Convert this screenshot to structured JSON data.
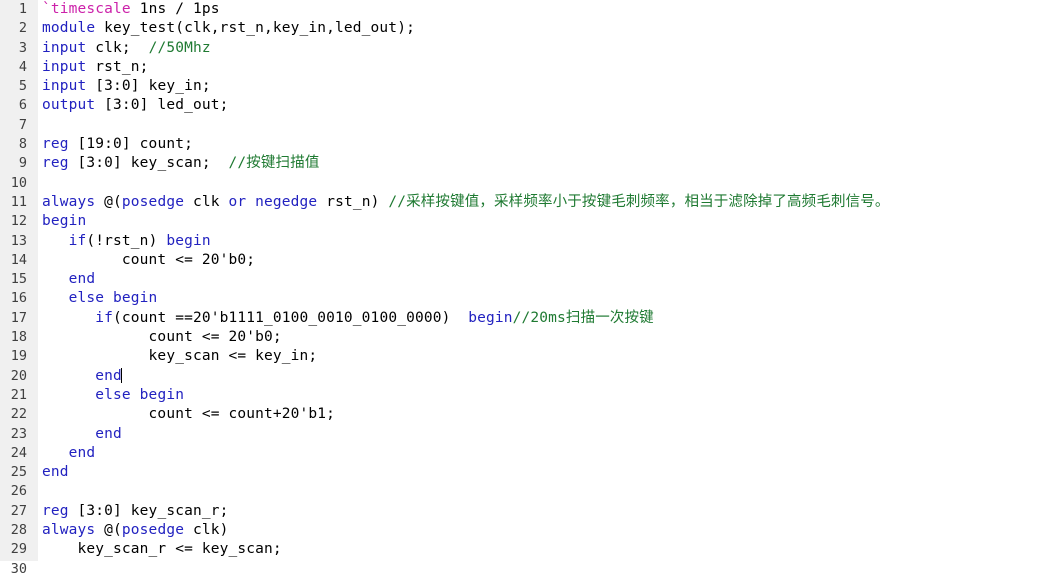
{
  "editor": {
    "language": "verilog",
    "file_kind": "source-code",
    "total_lines_visible": 30,
    "caret": {
      "line": 20,
      "after_text": "end"
    },
    "colors": {
      "background": "#ffffff",
      "gutter_background": "#f0f0f0",
      "line_number": "#404040",
      "plain": "#000000",
      "keyword": "#2222c0",
      "comment": "#1f7a32",
      "directive": "#cc22aa",
      "caret": "#000000"
    }
  },
  "lines": [
    {
      "number": "1",
      "tokens": [
        {
          "t": "directive",
          "s": "`timescale"
        },
        {
          "t": "plain",
          "s": " 1ns / 1ps"
        }
      ]
    },
    {
      "number": "2",
      "tokens": [
        {
          "t": "keyword",
          "s": "module"
        },
        {
          "t": "plain",
          "s": " key_test(clk,rst_n,key_in,led_out);"
        }
      ]
    },
    {
      "number": "3",
      "tokens": [
        {
          "t": "keyword",
          "s": "input"
        },
        {
          "t": "plain",
          "s": " clk;  "
        },
        {
          "t": "comment",
          "s": "//50Mhz"
        }
      ]
    },
    {
      "number": "4",
      "tokens": [
        {
          "t": "keyword",
          "s": "input"
        },
        {
          "t": "plain",
          "s": " rst_n;"
        }
      ]
    },
    {
      "number": "5",
      "tokens": [
        {
          "t": "keyword",
          "s": "input"
        },
        {
          "t": "plain",
          "s": " [3:0] key_in;"
        }
      ]
    },
    {
      "number": "6",
      "tokens": [
        {
          "t": "keyword",
          "s": "output"
        },
        {
          "t": "plain",
          "s": " [3:0] led_out;"
        }
      ]
    },
    {
      "number": "7",
      "tokens": []
    },
    {
      "number": "8",
      "tokens": [
        {
          "t": "keyword",
          "s": "reg"
        },
        {
          "t": "plain",
          "s": " [19:0] count;"
        }
      ]
    },
    {
      "number": "9",
      "tokens": [
        {
          "t": "keyword",
          "s": "reg"
        },
        {
          "t": "plain",
          "s": " [3:0] key_scan;  "
        },
        {
          "t": "comment",
          "s": "//按键扫描值"
        }
      ]
    },
    {
      "number": "10",
      "tokens": []
    },
    {
      "number": "11",
      "tokens": [
        {
          "t": "keyword",
          "s": "always"
        },
        {
          "t": "plain",
          "s": " @("
        },
        {
          "t": "keyword",
          "s": "posedge"
        },
        {
          "t": "plain",
          "s": " clk "
        },
        {
          "t": "keyword",
          "s": "or"
        },
        {
          "t": "plain",
          "s": " "
        },
        {
          "t": "keyword",
          "s": "negedge"
        },
        {
          "t": "plain",
          "s": " rst_n) "
        },
        {
          "t": "comment",
          "s": "//采样按键值，采样频率小于按键毛刺频率，相当于滤除掉了高频毛刺信号。"
        }
      ]
    },
    {
      "number": "12",
      "tokens": [
        {
          "t": "keyword",
          "s": "begin"
        }
      ]
    },
    {
      "number": "13",
      "tokens": [
        {
          "t": "plain",
          "s": "   "
        },
        {
          "t": "keyword",
          "s": "if"
        },
        {
          "t": "plain",
          "s": "(!rst_n) "
        },
        {
          "t": "keyword",
          "s": "begin"
        }
      ]
    },
    {
      "number": "14",
      "tokens": [
        {
          "t": "plain",
          "s": "         count <= 20'b0;"
        }
      ]
    },
    {
      "number": "15",
      "tokens": [
        {
          "t": "plain",
          "s": "   "
        },
        {
          "t": "keyword",
          "s": "end"
        }
      ]
    },
    {
      "number": "16",
      "tokens": [
        {
          "t": "plain",
          "s": "   "
        },
        {
          "t": "keyword",
          "s": "else begin"
        }
      ]
    },
    {
      "number": "17",
      "tokens": [
        {
          "t": "plain",
          "s": "      "
        },
        {
          "t": "keyword",
          "s": "if"
        },
        {
          "t": "plain",
          "s": "(count ==20'b1111_0100_0010_0100_0000)  "
        },
        {
          "t": "keyword",
          "s": "begin"
        },
        {
          "t": "comment",
          "s": "//20ms扫描一次按键"
        }
      ]
    },
    {
      "number": "18",
      "tokens": [
        {
          "t": "plain",
          "s": "            count <= 20'b0;"
        }
      ]
    },
    {
      "number": "19",
      "tokens": [
        {
          "t": "plain",
          "s": "            key_scan <= key_in;"
        }
      ]
    },
    {
      "number": "20",
      "tokens": [
        {
          "t": "plain",
          "s": "      "
        },
        {
          "t": "keyword",
          "s": "end"
        },
        {
          "t": "caret",
          "s": ""
        }
      ]
    },
    {
      "number": "21",
      "tokens": [
        {
          "t": "plain",
          "s": "      "
        },
        {
          "t": "keyword",
          "s": "else begin"
        }
      ]
    },
    {
      "number": "22",
      "tokens": [
        {
          "t": "plain",
          "s": "            count <= count+20'b1;"
        }
      ]
    },
    {
      "number": "23",
      "tokens": [
        {
          "t": "plain",
          "s": "      "
        },
        {
          "t": "keyword",
          "s": "end"
        }
      ]
    },
    {
      "number": "24",
      "tokens": [
        {
          "t": "plain",
          "s": "   "
        },
        {
          "t": "keyword",
          "s": "end"
        }
      ]
    },
    {
      "number": "25",
      "tokens": [
        {
          "t": "keyword",
          "s": "end"
        }
      ]
    },
    {
      "number": "26",
      "tokens": []
    },
    {
      "number": "27",
      "tokens": [
        {
          "t": "keyword",
          "s": "reg"
        },
        {
          "t": "plain",
          "s": " [3:0] key_scan_r;"
        }
      ]
    },
    {
      "number": "28",
      "tokens": [
        {
          "t": "keyword",
          "s": "always"
        },
        {
          "t": "plain",
          "s": " @("
        },
        {
          "t": "keyword",
          "s": "posedge"
        },
        {
          "t": "plain",
          "s": " clk)"
        }
      ]
    },
    {
      "number": "29",
      "tokens": [
        {
          "t": "plain",
          "s": "    key_scan_r <= key_scan;"
        }
      ]
    },
    {
      "number": "30",
      "tokens": []
    }
  ]
}
